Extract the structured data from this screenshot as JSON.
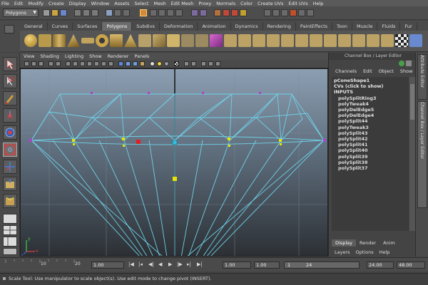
{
  "menubar": [
    "File",
    "Edit",
    "Modify",
    "Create",
    "Display",
    "Window",
    "Assets",
    "Select",
    "Mesh",
    "Edit Mesh",
    "Proxy",
    "Normals",
    "Color",
    "Create UVs",
    "Edit UVs",
    "Help"
  ],
  "status_line": {
    "mode": "Polygons"
  },
  "shelf_tabs": [
    {
      "label": "General",
      "active": false
    },
    {
      "label": "Curves",
      "active": false
    },
    {
      "label": "Surfaces",
      "active": false
    },
    {
      "label": "Polygons",
      "active": true
    },
    {
      "label": "Subdivs",
      "active": false
    },
    {
      "label": "Deformation",
      "active": false
    },
    {
      "label": "Animation",
      "active": false
    },
    {
      "label": "Dynamics",
      "active": false
    },
    {
      "label": "Rendering",
      "active": false
    },
    {
      "label": "PaintEffects",
      "active": false
    },
    {
      "label": "Toon",
      "active": false
    },
    {
      "label": "Muscle",
      "active": false
    },
    {
      "label": "Fluids",
      "active": false
    },
    {
      "label": "Fur",
      "active": false
    }
  ],
  "viewport_menu": [
    "View",
    "Shading",
    "Lighting",
    "Show",
    "Renderer",
    "Panels"
  ],
  "viewport_axis": {
    "x": "x",
    "y": "y",
    "z": "z"
  },
  "channel_box": {
    "title": "Channel Box / Layer Editor",
    "menu": [
      "Channels",
      "Edit",
      "Object",
      "Show"
    ],
    "shape": "pConeShape1",
    "cvs": "CVs (click to show)",
    "inputs_label": "INPUTS",
    "inputs": [
      "polySplitRing3",
      "polyTweak4",
      "polyDelEdge5",
      "polyDelEdge4",
      "polySplit44",
      "polyTweak3",
      "polySplit43",
      "polySplit42",
      "polySplit41",
      "polySplit40",
      "polySplit39",
      "polySplit38",
      "polySplit37"
    ]
  },
  "layer_editor": {
    "tabs": [
      {
        "label": "Display",
        "active": true
      },
      {
        "label": "Render",
        "active": false
      },
      {
        "label": "Anim",
        "active": false
      }
    ],
    "menu": [
      "Layers",
      "Options",
      "Help"
    ]
  },
  "side_tabs": [
    "Attribute Editor",
    "Channel Box / Layer Editor"
  ],
  "timeline": {
    "ticks": [
      "10",
      "20"
    ],
    "start_field": "1.00",
    "current_field": "1.00",
    "range_start": "1.00",
    "range_current": "1.00",
    "frame_min": "1",
    "frame_max": "24",
    "end_field": "24.00",
    "max_field": "48.00"
  },
  "help_line": "Scale Tool: Use manipulator to scale object(s). Use edit mode to change pivot (INSERT).",
  "colors": {
    "wire": "#6fd0e6",
    "vertex": "#e6e600",
    "selected": "#e02020",
    "center": "#30c0e0"
  }
}
